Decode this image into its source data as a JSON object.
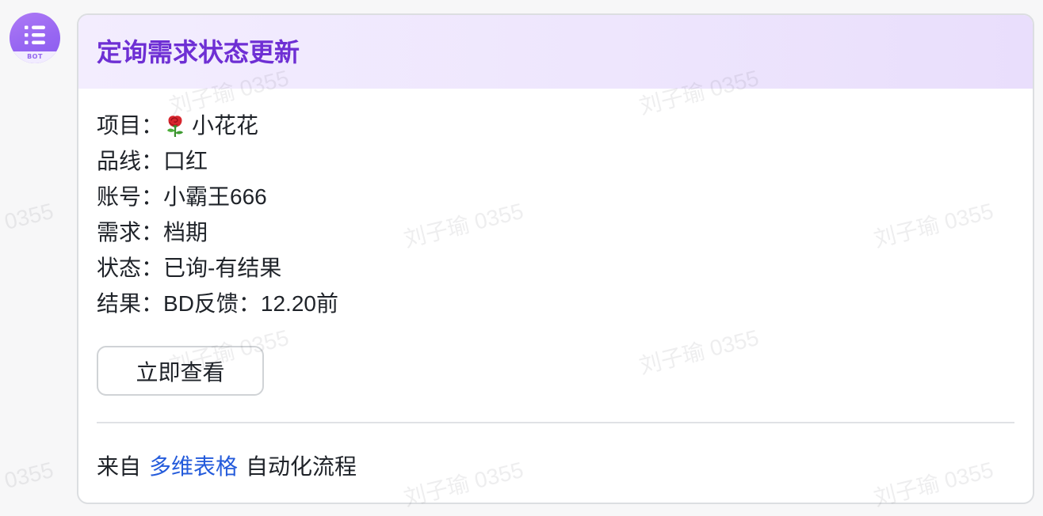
{
  "bot": {
    "avatar_icon": "list-icon",
    "badge": "BOT"
  },
  "card": {
    "title": "定询需求状态更新",
    "fields": [
      {
        "label": "项目：",
        "icon": "rose-emoji-icon",
        "value": "小花花"
      },
      {
        "label": "品线：",
        "value": "口红"
      },
      {
        "label": "账号：",
        "value": "小霸王666"
      },
      {
        "label": "需求：",
        "value": "档期"
      },
      {
        "label": "状态：",
        "value": "已询-有结果"
      },
      {
        "label": "结果：",
        "value": "BD反馈：12.20前"
      }
    ],
    "action_button": "立即查看",
    "footer": {
      "prefix": "来自",
      "source_link": "多维表格",
      "suffix": "自动化流程"
    }
  },
  "watermark": {
    "text": "刘子瑜 0355"
  },
  "colors": {
    "title": "#6e2fd4",
    "link": "#245bdb",
    "avatar": "#9766f2",
    "text": "#1f2329"
  }
}
